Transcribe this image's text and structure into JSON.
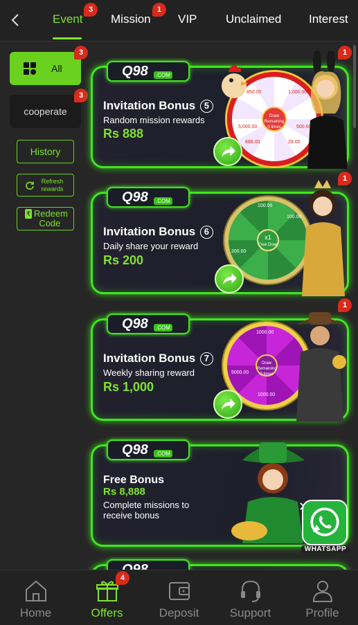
{
  "nav": {
    "tabs": [
      {
        "label": "Event",
        "badge": "3"
      },
      {
        "label": "Mission",
        "badge": "1"
      },
      {
        "label": "VIP"
      },
      {
        "label": "Unclaimed"
      },
      {
        "label": "Interest"
      }
    ]
  },
  "sidebar": {
    "all": {
      "label": "All",
      "badge": "3"
    },
    "cooperate": {
      "label": "cooperate",
      "badge": "3"
    },
    "history": "History",
    "refresh": "Refresh rewards",
    "redeem": "Redeem Code",
    "redeem_prefix": "₹"
  },
  "cards": [
    {
      "logo": "Q98",
      "logo_com": ".COM",
      "title": "Invitation Bonus",
      "num": "5",
      "subtitle": "Random mission rewards",
      "amount": "Rs 888",
      "badge": "1",
      "wheel_center": "Draw",
      "wheel_center2": "Remaining 0 times",
      "wheel_labels": [
        "850.00",
        "1,000.00",
        "5,000.00",
        "500.00",
        "888.00",
        "28.00"
      ]
    },
    {
      "logo": "Q98",
      "logo_com": ".COM",
      "title": "Invitation Bonus",
      "num": "6",
      "subtitle": "Daily share your reward",
      "amount": "Rs 200",
      "badge": "1",
      "wheel_center": "x1",
      "wheel_center2": "Free Draw",
      "wheel_labels": [
        "100.00",
        "100.00",
        "200.00"
      ]
    },
    {
      "logo": "Q98",
      "logo_com": ".COM",
      "title": "Invitation Bonus",
      "num": "7",
      "subtitle": "Weekly sharing reward",
      "amount": "Rs 1,000",
      "badge": "1",
      "wheel_center": "Draw",
      "wheel_center2": "Remaining 0 times",
      "wheel_labels": [
        "1000.00",
        "5000.00",
        "1000.00"
      ]
    },
    {
      "logo": "Q98",
      "logo_com": ".COM",
      "title": "Free Bonus",
      "amount": "Rs 8,888",
      "subtitle": "Complete missions to",
      "subtitle2": "receive bonus"
    }
  ],
  "whatsapp": {
    "label": "WHATSAPP",
    "close": "✕"
  },
  "bottom_nav": [
    {
      "label": "Home",
      "icon": "home-icon"
    },
    {
      "label": "Offers",
      "icon": "gift-icon",
      "badge": "4"
    },
    {
      "label": "Deposit",
      "icon": "wallet-icon"
    },
    {
      "label": "Support",
      "icon": "headset-icon"
    },
    {
      "label": "Profile",
      "icon": "user-icon"
    }
  ],
  "colors": {
    "accent": "#7ee32c",
    "badge": "#d92a1c",
    "card_border": "#42e61e",
    "background": "#262626"
  }
}
